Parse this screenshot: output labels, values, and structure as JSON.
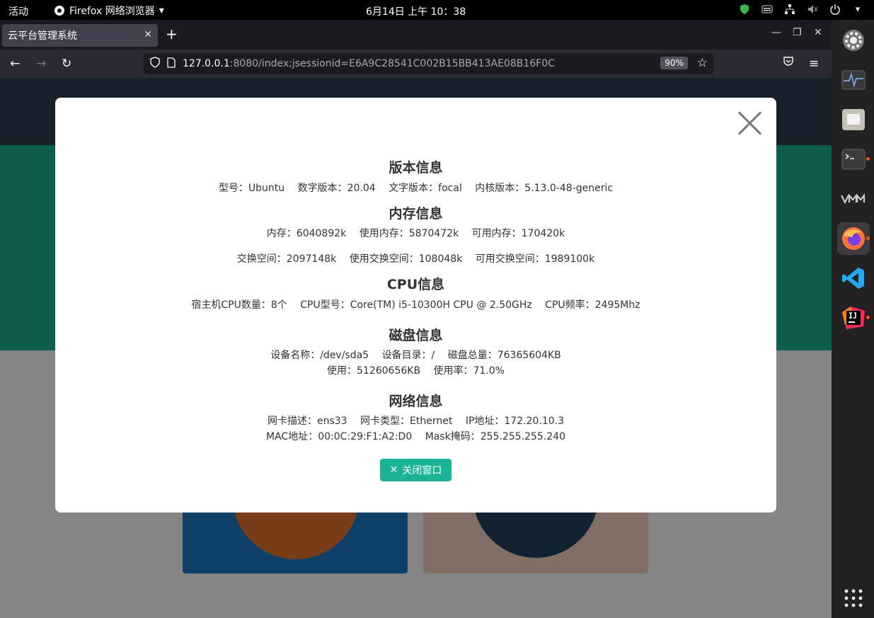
{
  "topbar": {
    "activities": "活动",
    "app_name": "Firefox 网络浏览器",
    "clock": "6月14日  上午 10：38"
  },
  "browser": {
    "tab_title": "云平台管理系统",
    "url_host": "127.0.0.1",
    "url_rest": ":8080/index;jsessionid=E6A9C28541C002B15BB413AE08B16F0C",
    "zoom": "90%"
  },
  "modal": {
    "version": {
      "title": "版本信息",
      "items": [
        "型号：Ubuntu",
        "数字版本：20.04",
        "文字版本：focal",
        "内核版本：5.13.0-48-generic"
      ]
    },
    "memory": {
      "title": "内存信息",
      "line1": [
        "内存：6040892k",
        "使用内存：5870472k",
        "可用内存：170420k"
      ],
      "line2": [
        "交换空间：2097148k",
        "使用交换空间：108048k",
        "可用交换空间：1989100k"
      ]
    },
    "cpu": {
      "title": "CPU信息",
      "items": [
        "宿主机CPU数量：8个",
        "CPU型号：Core(TM) i5-10300H CPU @ 2.50GHz",
        "CPU频率：2495Mhz"
      ]
    },
    "disk": {
      "title": "磁盘信息",
      "line1": [
        "设备名称：/dev/sda5",
        "设备目录：/",
        "磁盘总量：76365604KB"
      ],
      "line2": [
        "使用：51260656KB",
        "使用率：71.0%"
      ]
    },
    "network": {
      "title": "网络信息",
      "line1": [
        "网卡描述：ens33",
        "网卡类型：Ethernet",
        "IP地址：172.20.10.3"
      ],
      "line2": [
        "MAC地址：00:0C:29:F1:A2:D0",
        "Mask掩码：255.255.255.240"
      ]
    },
    "close_button": "关闭窗口"
  },
  "colors": {
    "accent": "#1ab394",
    "header": "#2f4050"
  }
}
